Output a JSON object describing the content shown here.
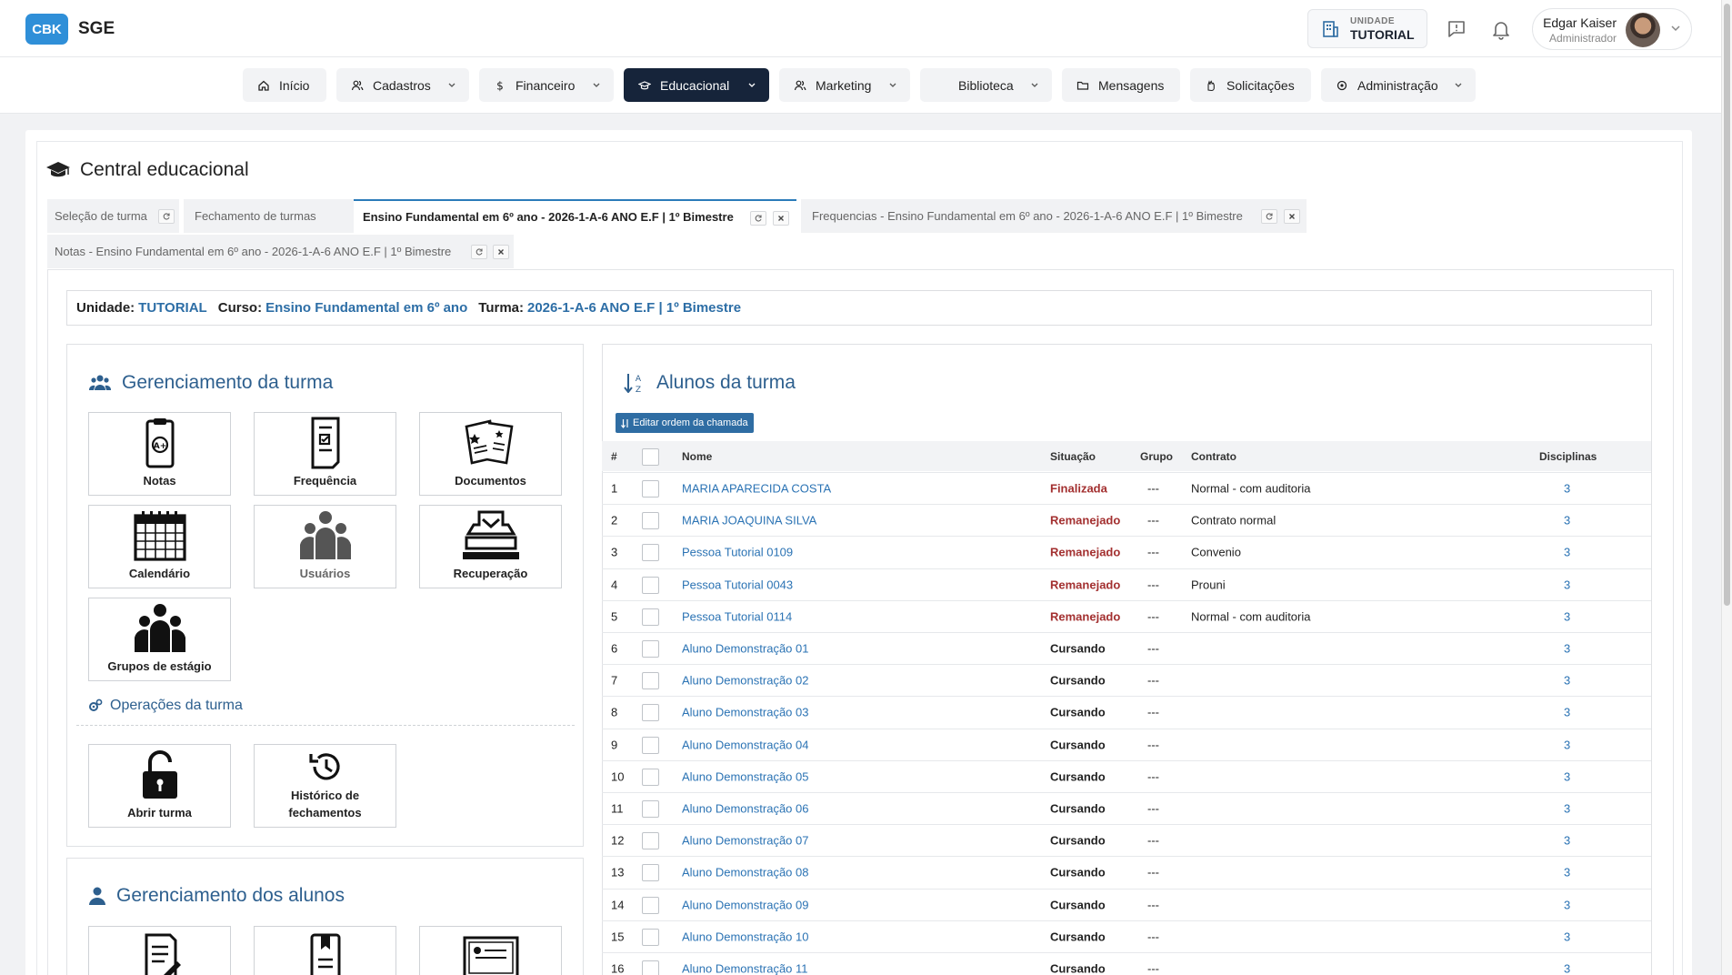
{
  "app": {
    "logo_badge": "CBK",
    "logo_text": "SGE"
  },
  "header": {
    "unit_label": "UNIDADE",
    "unit_value": "TUTORIAL",
    "user_name": "Edgar Kaiser",
    "user_role": "Administrador"
  },
  "nav": [
    {
      "label": "Início",
      "icon": "home-icon",
      "active": false
    },
    {
      "label": "Cadastros",
      "icon": "users-icon",
      "active": false
    },
    {
      "label": "Financeiro",
      "icon": "dollar-icon",
      "active": false
    },
    {
      "label": "Educacional",
      "icon": "graduation-cap-icon",
      "active": true
    },
    {
      "label": "Marketing",
      "icon": "users-icon",
      "active": false
    },
    {
      "label": "Biblioteca",
      "icon": "",
      "active": false
    },
    {
      "label": "Mensagens",
      "icon": "folder-icon",
      "active": false
    },
    {
      "label": "Solicitações",
      "icon": "hand-icon",
      "active": false
    },
    {
      "label": "Administração",
      "icon": "gear-icon",
      "active": false
    }
  ],
  "page": {
    "title": "Central educacional"
  },
  "tabs": [
    {
      "label": "Seleção de turma"
    },
    {
      "label": "Fechamento de turmas"
    },
    {
      "label": "Ensino Fundamental em 6º ano - 2026-1-A-6 ANO E.F | 1º Bimestre"
    },
    {
      "label": "Frequencias - Ensino Fundamental em 6º ano - 2026-1-A-6 ANO E.F | 1º Bimestre"
    },
    {
      "label": "Notas - Ensino Fundamental em 6º ano - 2026-1-A-6 ANO E.F | 1º Bimestre"
    }
  ],
  "info": {
    "unit_label": "Unidade:",
    "unit_value": "TUTORIAL",
    "course_label": "Curso:",
    "course_value": "Ensino Fundamental em 6º ano",
    "class_label": "Turma:",
    "class_value": "2026-1-A-6 ANO E.F | 1º Bimestre"
  },
  "class_management": {
    "title": "Gerenciamento da turma",
    "tiles": [
      "Notas",
      "Frequência",
      "Documentos",
      "Calendário",
      "Usuários",
      "Recuperação",
      "Grupos de estágio"
    ],
    "ops_title": "Operações da turma",
    "ops_tiles": [
      "Abrir turma",
      "Histórico de",
      "fechamentos"
    ]
  },
  "student_management": {
    "title": "Gerenciamento dos alunos"
  },
  "students": {
    "title": "Alunos da turma",
    "edit_button": "Editar ordem da chamada",
    "columns": [
      "#",
      "Nome",
      "Situação",
      "Grupo",
      "Contrato",
      "Disciplinas"
    ],
    "rows": [
      {
        "n": "1",
        "name": "MARIA APARECIDA COSTA",
        "status": "Finalizada",
        "group": "---",
        "contract": "Normal - com auditoria",
        "disc": "3"
      },
      {
        "n": "2",
        "name": "MARIA JOAQUINA SILVA",
        "status": "Remanejado",
        "group": "---",
        "contract": "Contrato normal",
        "disc": "3"
      },
      {
        "n": "3",
        "name": "Pessoa Tutorial 0109",
        "status": "Remanejado",
        "group": "---",
        "contract": "Convenio",
        "disc": "3"
      },
      {
        "n": "4",
        "name": "Pessoa Tutorial 0043",
        "status": "Remanejado",
        "group": "---",
        "contract": "Prouni",
        "disc": "3"
      },
      {
        "n": "5",
        "name": "Pessoa Tutorial 0114",
        "status": "Remanejado",
        "group": "---",
        "contract": "Normal - com auditoria",
        "disc": "3"
      },
      {
        "n": "6",
        "name": "Aluno Demonstração 01",
        "status": "Cursando",
        "group": "---",
        "contract": "",
        "disc": "3"
      },
      {
        "n": "7",
        "name": "Aluno Demonstração 02",
        "status": "Cursando",
        "group": "---",
        "contract": "",
        "disc": "3"
      },
      {
        "n": "8",
        "name": "Aluno Demonstração 03",
        "status": "Cursando",
        "group": "---",
        "contract": "",
        "disc": "3"
      },
      {
        "n": "9",
        "name": "Aluno Demonstração 04",
        "status": "Cursando",
        "group": "---",
        "contract": "",
        "disc": "3"
      },
      {
        "n": "10",
        "name": "Aluno Demonstração 05",
        "status": "Cursando",
        "group": "---",
        "contract": "",
        "disc": "3"
      },
      {
        "n": "11",
        "name": "Aluno Demonstração 06",
        "status": "Cursando",
        "group": "---",
        "contract": "",
        "disc": "3"
      },
      {
        "n": "12",
        "name": "Aluno Demonstração 07",
        "status": "Cursando",
        "group": "---",
        "contract": "",
        "disc": "3"
      },
      {
        "n": "13",
        "name": "Aluno Demonstração 08",
        "status": "Cursando",
        "group": "---",
        "contract": "",
        "disc": "3"
      },
      {
        "n": "14",
        "name": "Aluno Demonstração 09",
        "status": "Cursando",
        "group": "---",
        "contract": "",
        "disc": "3"
      },
      {
        "n": "15",
        "name": "Aluno Demonstração 10",
        "status": "Cursando",
        "group": "---",
        "contract": "",
        "disc": "3"
      },
      {
        "n": "16",
        "name": "Aluno Demonstração 11",
        "status": "Cursando",
        "group": "---",
        "contract": "",
        "disc": "3"
      }
    ]
  },
  "colors": {
    "brand": "#2f8fd8",
    "nav_active": "#16243a",
    "link": "#2b73b4",
    "status_red": "#a33030",
    "section_title": "#2d5f8e"
  }
}
